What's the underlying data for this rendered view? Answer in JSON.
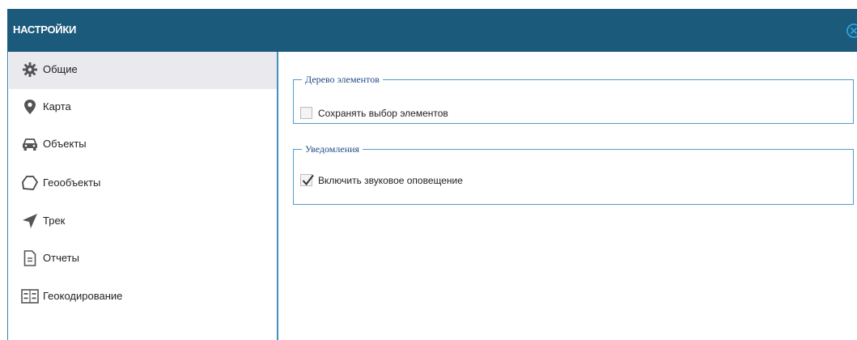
{
  "dialog": {
    "title": "НАСТРОЙКИ"
  },
  "sidebar": {
    "items": [
      {
        "label": "Общие",
        "icon": "gear-icon",
        "active": true
      },
      {
        "label": "Карта",
        "icon": "map-pin-icon",
        "active": false
      },
      {
        "label": "Объекты",
        "icon": "car-icon",
        "active": false
      },
      {
        "label": "Геообъекты",
        "icon": "polygon-icon",
        "active": false
      },
      {
        "label": "Трек",
        "icon": "navigation-arrow-icon",
        "active": false
      },
      {
        "label": "Отчеты",
        "icon": "document-icon",
        "active": false
      },
      {
        "label": "Геокодирование",
        "icon": "geocoding-icon",
        "active": false
      }
    ]
  },
  "settings": {
    "groups": [
      {
        "legend": "Дерево элементов",
        "options": [
          {
            "label": "Сохранять выбор элементов",
            "checked": false
          }
        ]
      },
      {
        "legend": "Уведомления",
        "options": [
          {
            "label": "Включить звуковое оповещение",
            "checked": true
          }
        ]
      }
    ]
  },
  "colors": {
    "titlebar": "#1c5a7c",
    "accent_border": "#3f92bf",
    "legend_text": "#1d4b86",
    "active_item_bg": "#e9e9ee"
  }
}
